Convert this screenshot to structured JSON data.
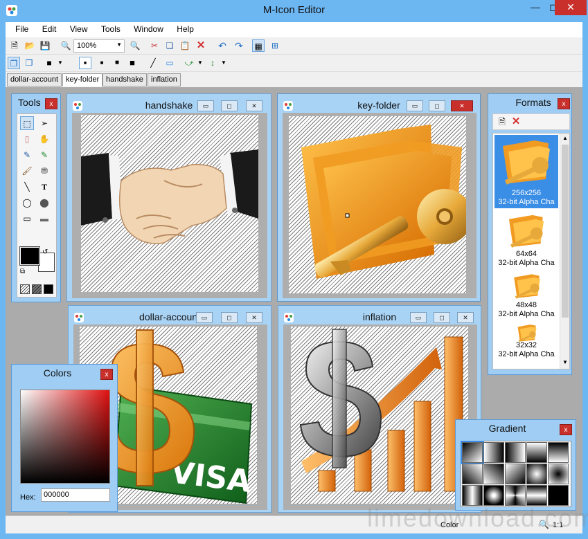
{
  "window": {
    "title": "M-Icon Editor"
  },
  "menu": [
    "File",
    "Edit",
    "View",
    "Tools",
    "Window",
    "Help"
  ],
  "toolbar": {
    "zoom_value": "100%"
  },
  "tabs": [
    "dollar-account",
    "key-folder",
    "handshake",
    "inflation"
  ],
  "active_tab": "key-folder",
  "panels": {
    "tools": {
      "title": "Tools",
      "close": "x"
    },
    "formats": {
      "title": "Formats",
      "close": "x",
      "items": [
        {
          "size": "256x256",
          "depth": "32-bit Alpha Cha",
          "selected": true
        },
        {
          "size": "64x64",
          "depth": "32-bit Alpha Cha",
          "selected": false
        },
        {
          "size": "48x48",
          "depth": "32-bit Alpha Cha",
          "selected": false
        },
        {
          "size": "32x32",
          "depth": "32-bit Alpha Cha",
          "selected": false
        }
      ]
    },
    "colors": {
      "title": "Colors",
      "close": "x",
      "hex_label": "Hex:",
      "hex_value": "000000"
    },
    "gradient": {
      "title": "Gradient",
      "close": "x"
    }
  },
  "documents": [
    {
      "id": "handshake",
      "title": "handshake"
    },
    {
      "id": "key-folder",
      "title": "key-folder"
    },
    {
      "id": "dollar-account",
      "title": "dollar-account"
    },
    {
      "id": "inflation",
      "title": "inflation"
    }
  ],
  "doc_buttons": {
    "minimize": "▭",
    "maximize": "◻",
    "close": "✕"
  },
  "artwork": {
    "visa_text": "VISA"
  },
  "statusbar": {
    "mode": "Color",
    "zoom": "1:1"
  },
  "watermark": "limedownload.com",
  "colors": {
    "titlebar": "#6cb6f2",
    "panel": "#9fcdf3",
    "selection": "#3b8ee6",
    "close_red": "#c9302c",
    "workspace": "#ababab"
  }
}
